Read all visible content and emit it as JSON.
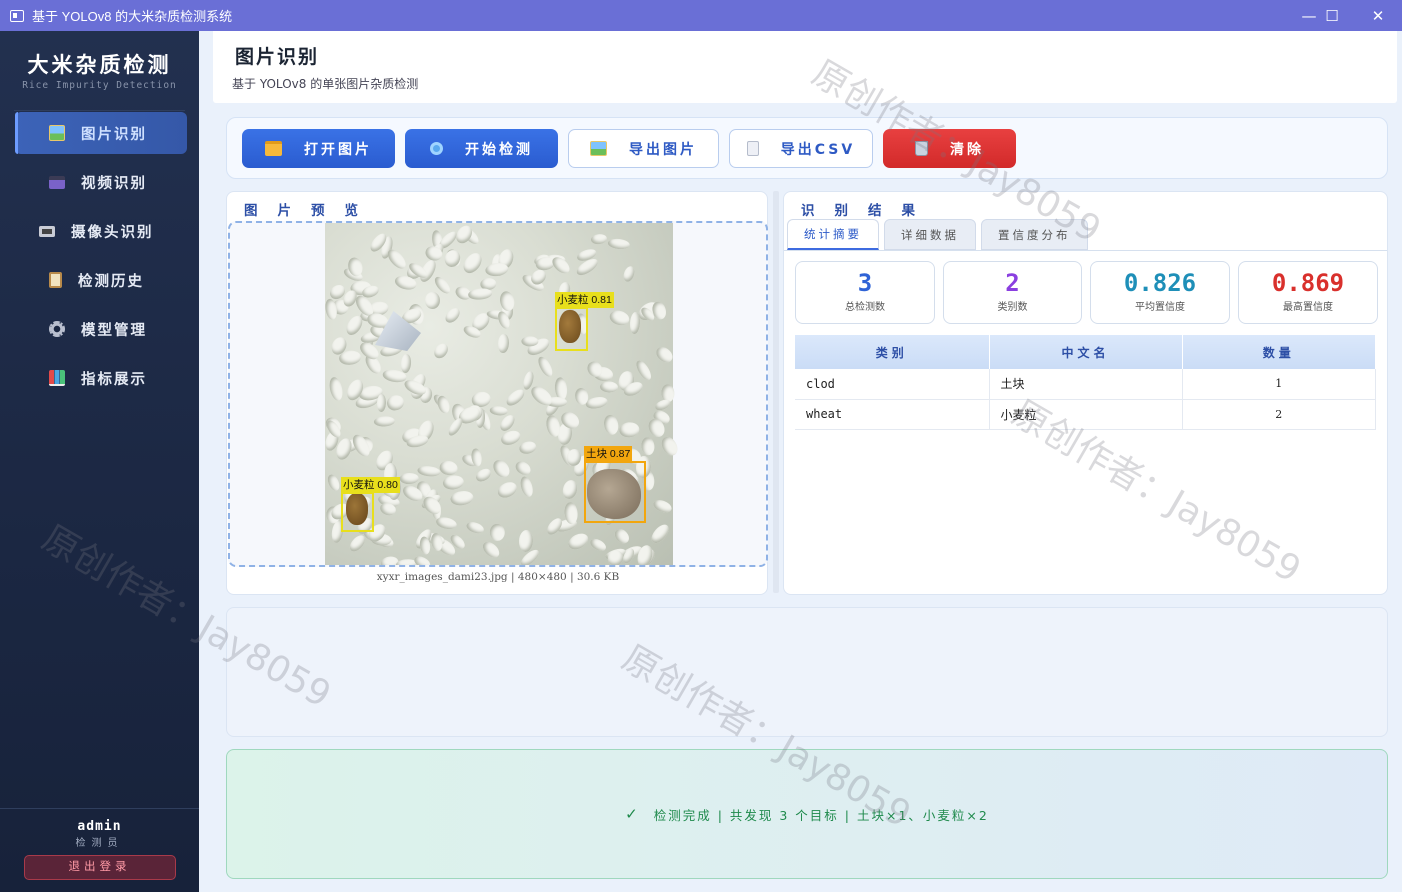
{
  "window": {
    "title": "基于 YOLOv8 的大米杂质检测系统",
    "controls": {
      "minimize": "—",
      "maximize": "☐",
      "close": "✕"
    }
  },
  "sidebar": {
    "brand_name": "大米杂质检测",
    "brand_sub": "Rice Impurity Detection",
    "items": [
      {
        "label": "图片识别",
        "icon": "image-icon",
        "active": true
      },
      {
        "label": "视频识别",
        "icon": "clapper-icon",
        "active": false
      },
      {
        "label": "摄像头识别",
        "icon": "camera-icon",
        "active": false
      },
      {
        "label": "检测历史",
        "icon": "clipboard-icon",
        "active": false
      },
      {
        "label": "模型管理",
        "icon": "gear-icon",
        "active": false
      },
      {
        "label": "指标展示",
        "icon": "chart-icon",
        "active": false
      }
    ],
    "user": "admin",
    "role": "检测员",
    "logout_label": "退出登录"
  },
  "header": {
    "title": "图片识别",
    "subtitle": "基于 YOLOv8 的单张图片杂质检测"
  },
  "toolbar": {
    "open_label": "打开图片",
    "detect_label": "开始检测",
    "export_image_label": "导出图片",
    "export_csv_label": "导出CSV",
    "clear_label": "清除"
  },
  "preview": {
    "title": "图片预览",
    "file_info": "xyxr_images_dami23.jpg  |  480×480  |  30.6 KB",
    "detections": [
      {
        "label": "小麦粒 0.81",
        "color": "#e8df1c"
      },
      {
        "label": "土块 0.87",
        "color": "#f2a60e"
      },
      {
        "label": "小麦粒 0.80",
        "color": "#e8df1c"
      }
    ]
  },
  "results": {
    "title": "识别结果",
    "tabs": [
      "统计摘要",
      "详细数据",
      "置信度分布"
    ],
    "stats": [
      {
        "value": "3",
        "label": "总检测数",
        "color": "#2f63d6"
      },
      {
        "value": "2",
        "label": "类别数",
        "color": "#8a3fe0"
      },
      {
        "value": "0.826",
        "label": "平均置信度",
        "color": "#1e8fb8"
      },
      {
        "value": "0.869",
        "label": "最高置信度",
        "color": "#d9302c"
      }
    ],
    "table": {
      "headers": [
        "类别",
        "中文名",
        "数量"
      ],
      "rows": [
        [
          "clod",
          "土块",
          "1"
        ],
        [
          "wheat",
          "小麦粒",
          "2"
        ]
      ]
    }
  },
  "status": {
    "check": "✓",
    "message": "检测完成  |  共发现 3 个目标  |  土块×1、小麦粒×2"
  },
  "watermark": "原创作者：Jay8059"
}
